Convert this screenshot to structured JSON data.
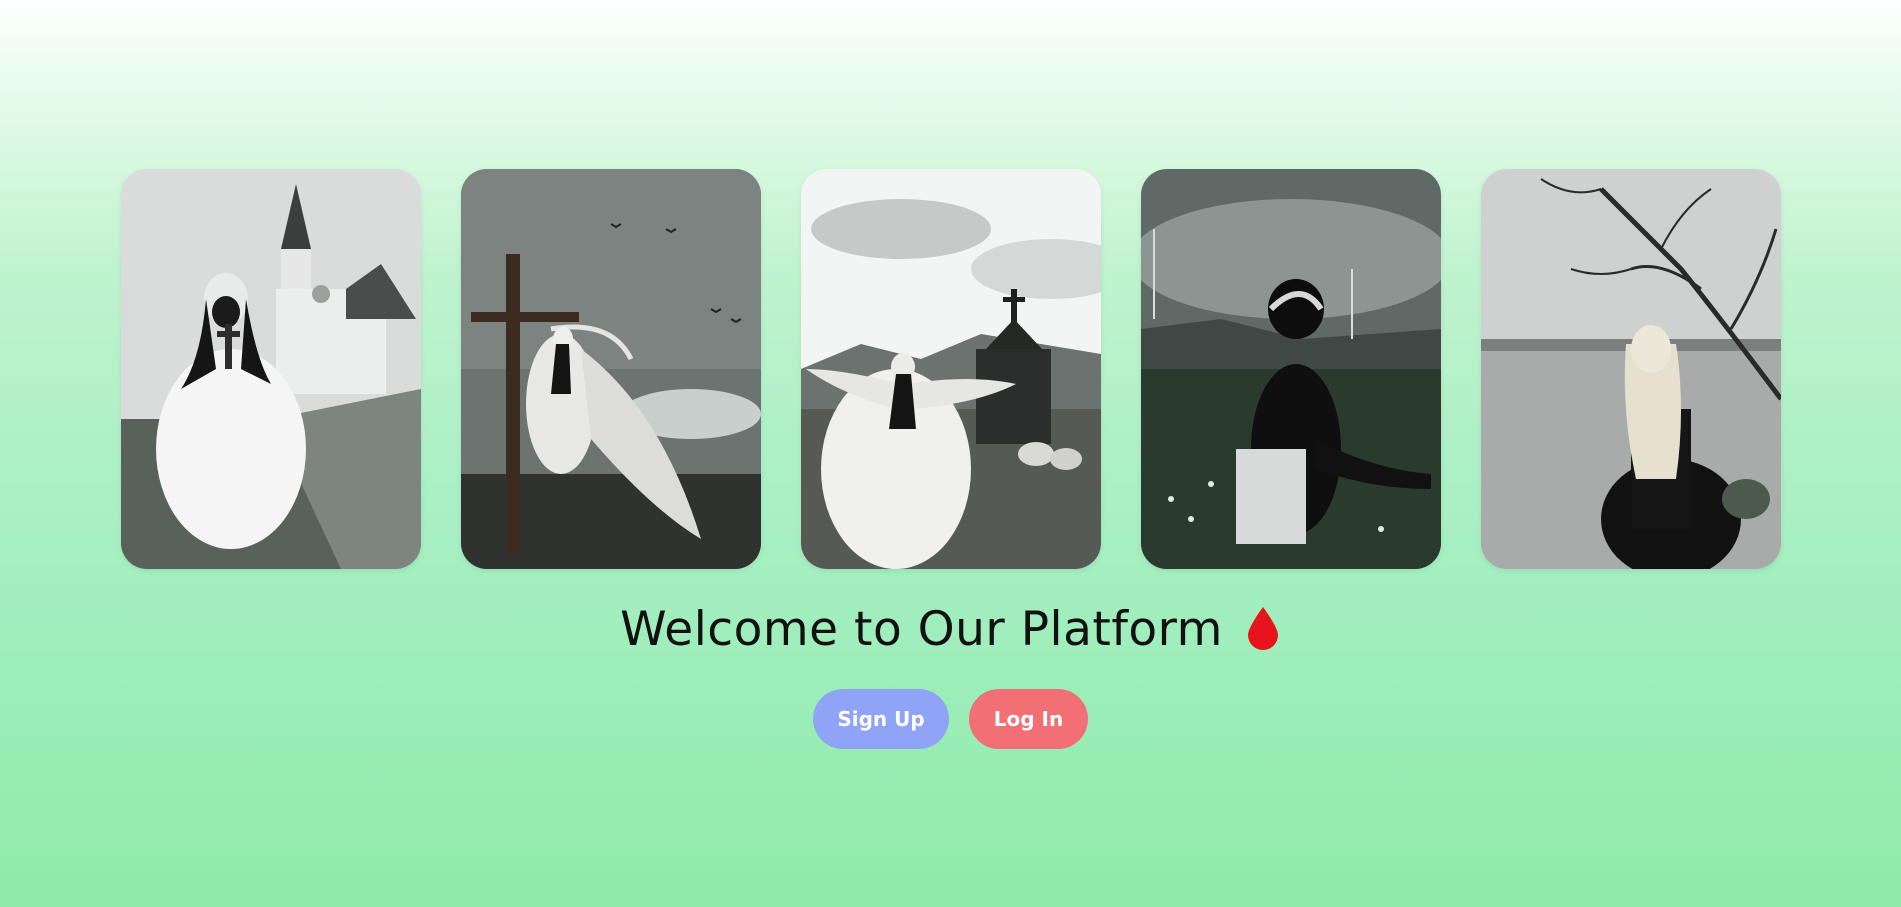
{
  "gallery": {
    "images": [
      {
        "alt": "Gothic figure in white dress holding a cross before a church",
        "tone": "#9aa19c"
      },
      {
        "alt": "Veiled figure in white beside a wooden cross under stormy sky",
        "tone": "#6f7572"
      },
      {
        "alt": "Figure in white gown with outstretched arms before a chapel",
        "tone": "#c9cdcb"
      },
      {
        "alt": "Dark-haired figure seated on grassy hillside with wind turbines",
        "tone": "#4b5550"
      },
      {
        "alt": "Blonde figure in black dress by a lake under bare branches",
        "tone": "#b8bbb9"
      }
    ]
  },
  "hero": {
    "title": "Welcome to Our Platform",
    "icon": "blood-drop-icon",
    "icon_color": "#e8141c"
  },
  "actions": {
    "signup_label": "Sign Up",
    "login_label": "Log In",
    "signup_color": "#8fa3f7",
    "login_color": "#f16f75"
  }
}
